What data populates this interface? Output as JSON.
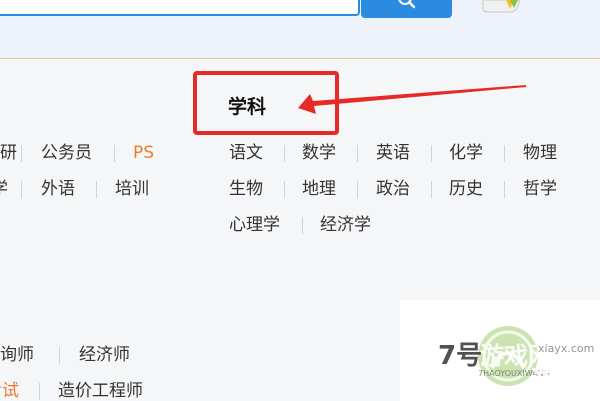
{
  "search": {
    "value": "",
    "placeholder": ""
  },
  "section": {
    "title": "学科"
  },
  "left_categories": {
    "row1": [
      "考研",
      "公务员",
      "PS"
    ],
    "row2": [
      "留学",
      "外语",
      "培训"
    ],
    "row3": [
      "咨询师",
      "经济师"
    ],
    "row4": [
      "考试",
      "造价工程师"
    ]
  },
  "subjects": {
    "row1": [
      "语文",
      "数学",
      "英语",
      "化学",
      "物理"
    ],
    "row2": [
      "生物",
      "地理",
      "政治",
      "历史",
      "哲学"
    ],
    "row3": [
      "心理学",
      "经济学"
    ]
  },
  "watermark": {
    "number": "7号",
    "text": "游戏网",
    "pinyin": "7HAOYOUXIWANG",
    "domain": "xiayx.com",
    "game": "游戏"
  },
  "colors": {
    "accent": "#2b8be0",
    "highlight": "#e62b26",
    "orange": "#ef7a2a"
  },
  "icons": {
    "search": "magnifier-icon",
    "promo": "promo-icon"
  }
}
